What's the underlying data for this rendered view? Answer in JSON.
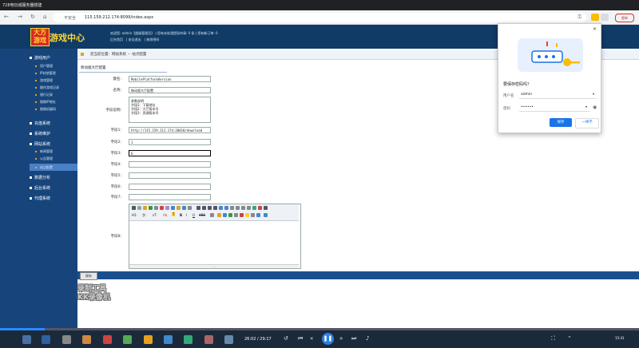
{
  "window": {
    "title": "728电玩城服务器搭建"
  },
  "browser": {
    "insecure_label": "不安全",
    "url": "115.159.212.174:8099/index.aspx",
    "update_label": "更新",
    "ext_colors": [
      "#fbbc04",
      "#1a73e8",
      "#5f6368"
    ]
  },
  "site": {
    "logo_line1": "大方",
    "logo_line2": "游戏",
    "title": "游戏中心",
    "welcome": "欢迎您: admin【超级管理员】 | 您有未处理提现申请: 0 条 | 您有新订单: 0",
    "links": [
      "后台首页",
      "安全退出",
      "修改密码"
    ]
  },
  "sidebar": {
    "groups": [
      {
        "label": "游戏用户",
        "children": [
          "用户管理",
          "IP封禁管理",
          "游戏管理",
          "操作游戏记录",
          "银行记录",
          "限制IP地址",
          "限制机器码"
        ]
      },
      {
        "label": "充值系统",
        "children": []
      },
      {
        "label": "系统维护",
        "children": []
      },
      {
        "label": "网站系统",
        "children": [
          "新闻管理",
          "公告管理",
          "站点配置"
        ]
      },
      {
        "label": "数据分析",
        "children": []
      },
      {
        "label": "后台系统",
        "children": []
      },
      {
        "label": "代理系统",
        "children": []
      }
    ]
  },
  "content": {
    "breadcrumb": "您当前位置：网站系统 － 站点配置",
    "tab": "移动版大厅配置",
    "fields": [
      {
        "label": "键名：",
        "value": "MobilePlatformVersion"
      },
      {
        "label": "名称：",
        "value": "移动版大厅配置"
      },
      {
        "label": "字段说明：",
        "lines": [
          "参数说明",
          "字段1：下载地址",
          "字段2：大厅版本号",
          "字段3：资源版本号"
        ]
      },
      {
        "label": "字段1：",
        "value": "http://115.159.212.174:20010/download"
      },
      {
        "label": "字段2：",
        "value": "1"
      },
      {
        "label": "字段3：",
        "value": "6"
      },
      {
        "label": "字段4：",
        "value": ""
      },
      {
        "label": "字段5：",
        "value": ""
      },
      {
        "label": "字段6：",
        "value": ""
      },
      {
        "label": "字段7：",
        "value": ""
      },
      {
        "label": "字段8：",
        "value": ""
      }
    ],
    "editor_toolbar_row2": [
      "H1·",
      "字·",
      "sT·",
      "Ab",
      "T",
      "B",
      "I",
      "U",
      "ABC"
    ],
    "save_button": "保存"
  },
  "watermark": {
    "line1": "录制工具",
    "line2": "KK录像机"
  },
  "password_popup": {
    "title": "要保存密码吗？",
    "username_label": "用户名",
    "username_value": "admin",
    "password_label": "密码",
    "password_value": "••••••",
    "save_label": "保存",
    "never_label": "一律不",
    "accent": "#1a73e8"
  },
  "player": {
    "time": "26:02 / 29:17",
    "progress_fraction": 0.07,
    "clock": "15:41"
  }
}
